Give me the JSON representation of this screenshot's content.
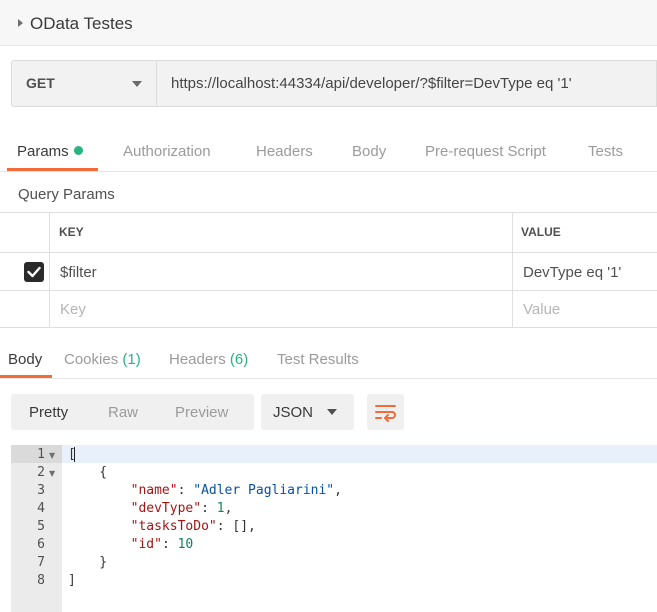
{
  "collection": {
    "title": "OData Testes"
  },
  "request": {
    "method": "GET",
    "url": "https://localhost:44334/api/developer/?$filter=DevType eq '1'"
  },
  "request_tabs": [
    "Params",
    "Authorization",
    "Headers",
    "Body",
    "Pre-request Script",
    "Tests"
  ],
  "query_params": {
    "label": "Query Params",
    "columns": {
      "key": "KEY",
      "value": "VALUE"
    },
    "rows": [
      {
        "key": "$filter",
        "value": "DevType eq '1'",
        "checked": true
      }
    ],
    "placeholders": {
      "key": "Key",
      "value": "Value"
    }
  },
  "response_tabs": [
    {
      "label": "Body",
      "count": ""
    },
    {
      "label": "Cookies",
      "count": "(1)"
    },
    {
      "label": "Headers",
      "count": "(6)"
    },
    {
      "label": "Test Results",
      "count": ""
    }
  ],
  "response_view": {
    "modes": [
      "Pretty",
      "Raw",
      "Preview"
    ],
    "format": "JSON"
  },
  "response_body": {
    "line_numbers": [
      "1",
      "2",
      "3",
      "4",
      "5",
      "6",
      "7",
      "8"
    ],
    "lines": [
      {
        "p": "["
      },
      {
        "p": "    {"
      },
      {
        "k": "\"name\"",
        "p": ": ",
        "s": "\"Adler Pagliarini\"",
        "e": ","
      },
      {
        "k": "\"devType\"",
        "p": ": ",
        "n": "1",
        "e": ","
      },
      {
        "k": "\"tasksToDo\"",
        "p": ": [],",
        "e": ""
      },
      {
        "k": "\"id\"",
        "p": ": ",
        "n": "10",
        "e": ""
      },
      {
        "p": "    }"
      },
      {
        "p": "]"
      }
    ]
  },
  "colors": {
    "accent": "#f26b3a",
    "success": "#26b47f"
  }
}
